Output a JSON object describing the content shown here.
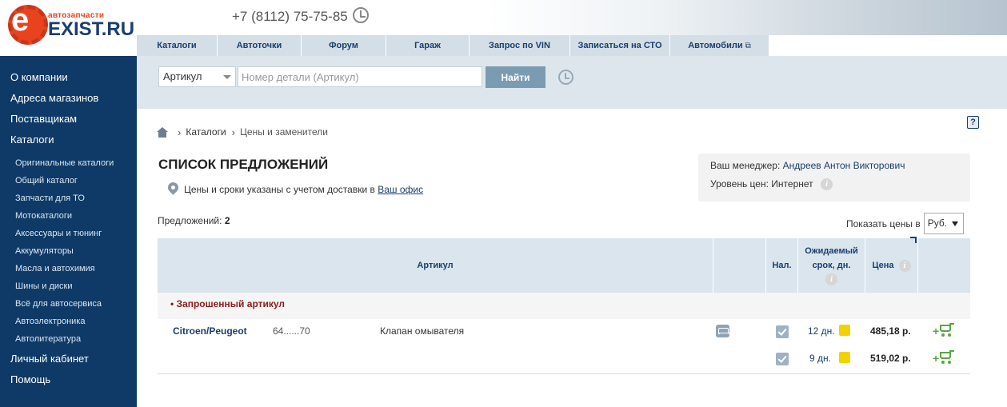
{
  "header": {
    "logo_small": "автозапчасти",
    "logo_main": "EXIST.RU",
    "logo_letter": "e",
    "phone": "+7 (8112) 75-75-85"
  },
  "nav": [
    {
      "label": "Каталоги"
    },
    {
      "label": "Автоточки"
    },
    {
      "label": "Форум"
    },
    {
      "label": "Гараж"
    },
    {
      "label": "Запрос по VIN"
    },
    {
      "label": "Записаться на СТО"
    },
    {
      "label": "Автомобили",
      "external_icon": "⧉"
    }
  ],
  "sidebar": {
    "top_items": [
      "О компании",
      "Адреса магазинов",
      "Поставщикам",
      "Каталоги"
    ],
    "catalog_items": [
      "Оригинальные каталоги",
      "Общий каталог",
      "Запчасти для ТО",
      "Мотокаталоги",
      "Аксессуары и тюнинг",
      "Аккумуляторы",
      "Масла и автохимия",
      "Шины и диски",
      "Всё для автосервиса",
      "Автоэлектроника",
      "Автолитература"
    ],
    "bottom_items": [
      "Личный кабинет",
      "Помощь"
    ]
  },
  "search": {
    "type_selected": "Артикул",
    "placeholder": "Номер детали (Артикул)",
    "button_label": "Найти"
  },
  "breadcrumb": {
    "sep": "›",
    "items": [
      "Каталоги",
      "Цены и заменители"
    ]
  },
  "page": {
    "title": "СПИСОК ПРЕДЛОЖЕНИЙ",
    "delivery_note": "Цены и сроки указаны с учетом доставки в",
    "office_link": "Ваш офис",
    "help_label": "?"
  },
  "manager": {
    "manager_label": "Ваш менеджер:",
    "manager_name": "Андреев Антон Викторович",
    "price_level_label": "Уровень цен:",
    "price_level_value": "Интернет",
    "info_glyph": "i"
  },
  "offers": {
    "count_label": "Предложений:",
    "count": "2",
    "currency_label": "Показать цены в",
    "currency_selected": "Руб."
  },
  "table": {
    "headers": {
      "article": "Артикул",
      "stock": "Нал.",
      "expected_1": "Ожидаемый",
      "expected_2": "срок, дн.",
      "price": "Цена"
    },
    "requested_label": "• Запрошенный артикул",
    "brand": "Citroen/Peugeot",
    "article": "64......70",
    "description": "Клапан омывателя",
    "rows": [
      {
        "days": "12 дн.",
        "price": "485,18 р."
      },
      {
        "days": "9 дн.",
        "price": "519,02 р."
      }
    ]
  },
  "colors": {
    "sidebar_bg": "#0f3a67",
    "accent_blue": "#1a3e6e",
    "requested_red": "#8b1c1c",
    "status_yellow": "#f2d200",
    "cart_green": "#5aa640",
    "search_button": "#7b9bb2"
  }
}
